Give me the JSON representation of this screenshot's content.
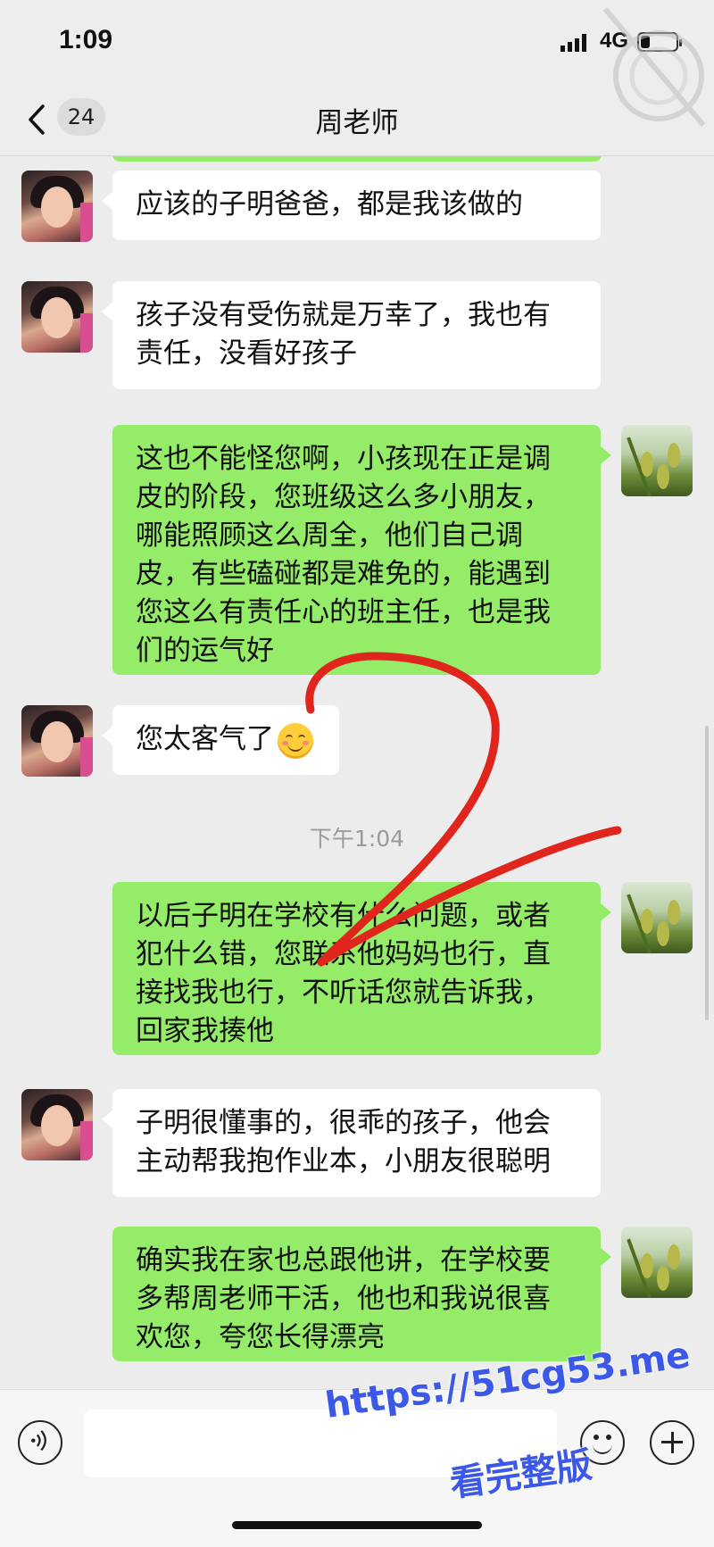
{
  "status_bar": {
    "time": "1:09",
    "network": "4G",
    "battery_level": 0.25
  },
  "nav": {
    "unread_count": "24",
    "title": "周老师"
  },
  "messages": [
    {
      "side": "left",
      "text": "应该的子明爸爸，都是我该做的"
    },
    {
      "side": "left",
      "text": "孩子没有受伤就是万幸了，我也有\n责任，没看好孩子"
    },
    {
      "side": "right",
      "text": "这也不能怪您啊，小孩现在正是调\n皮的阶段，您班级这么多小朋友，\n哪能照顾这么周全，他们自己调\n皮，有些磕碰都是难免的，能遇到\n您这么有责任心的班主任，也是我\n们的运气好"
    },
    {
      "side": "left",
      "text": "您太客气了"
    },
    {
      "side": "right",
      "text": "以后子明在学校有什么问题，或者\n犯什么错，您联系他妈妈也行，直\n接找我也行，不听话您就告诉我，\n回家我揍他"
    },
    {
      "side": "left",
      "text": "子明很懂事的，很乖的孩子，他会\n主动帮我抱作业本，小朋友很聪明"
    },
    {
      "side": "right",
      "text": "确实我在家也总跟他讲，在学校要\n多帮周老师干活，他也和我说很喜\n欢您，夸您长得漂亮"
    }
  ],
  "timestamp": "下午1:04",
  "annotation_color": "#e0261c",
  "watermark": {
    "url": "https://51cg53.me",
    "text": "看完整版",
    "color": "#3c58e8"
  },
  "colors": {
    "bubble_green": "#95ec69",
    "bubble_white": "#ffffff",
    "background": "#ececec"
  }
}
